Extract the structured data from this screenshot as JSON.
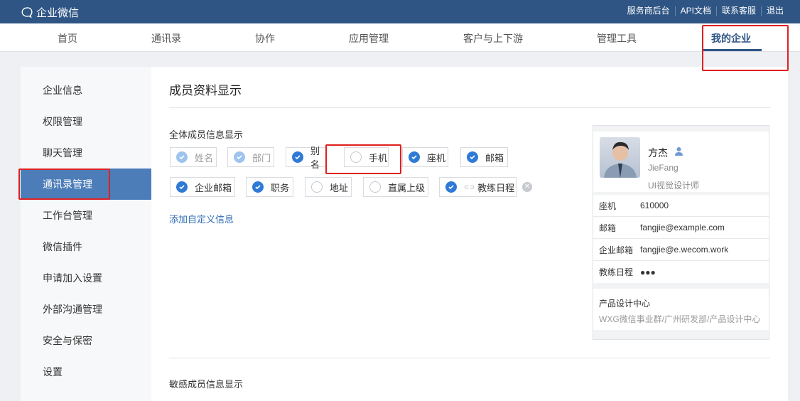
{
  "header": {
    "logo": "企业微信",
    "links": [
      "服务商后台",
      "API文档",
      "联系客服",
      "退出"
    ]
  },
  "nav": {
    "items": [
      "首页",
      "通讯录",
      "协作",
      "应用管理",
      "客户与上下游",
      "管理工具",
      "我的企业"
    ],
    "active": "我的企业"
  },
  "sidebar": {
    "items": [
      "企业信息",
      "权限管理",
      "聊天管理",
      "通讯录管理",
      "工作台管理",
      "微信插件",
      "申请加入设置",
      "外部沟通管理",
      "安全与保密",
      "设置"
    ],
    "active": "通讯录管理"
  },
  "main": {
    "title": "成员资料显示",
    "section_all": "全体成员信息显示",
    "fields": [
      {
        "label": "姓名",
        "state": "locked"
      },
      {
        "label": "部门",
        "state": "locked"
      },
      {
        "label": "别名",
        "state": "checked"
      },
      {
        "label": "手机",
        "state": "unchecked"
      },
      {
        "label": "座机",
        "state": "checked"
      },
      {
        "label": "邮箱",
        "state": "checked"
      },
      {
        "label": "企业邮箱",
        "state": "checked"
      },
      {
        "label": "职务",
        "state": "checked"
      },
      {
        "label": "地址",
        "state": "unchecked"
      },
      {
        "label": "直属上级",
        "state": "unchecked"
      },
      {
        "label": "教练日程",
        "state": "checked"
      }
    ],
    "add_custom": "添加自定义信息",
    "section_sensitive": "敏感成员信息显示"
  },
  "preview": {
    "name": "方杰",
    "english_name": "JieFang",
    "position": "UI视觉设计师",
    "rows": [
      {
        "k": "座机",
        "v": "610000"
      },
      {
        "k": "邮箱",
        "v": "fangjie@example.com"
      },
      {
        "k": "企业邮箱",
        "v": "fangjie@e.wecom.work"
      },
      {
        "k": "教练日程",
        "v": "●●●"
      }
    ],
    "dept": "产品设计中心",
    "dept_path": "WXG微信事业群/广州研发部/产品设计中心"
  }
}
